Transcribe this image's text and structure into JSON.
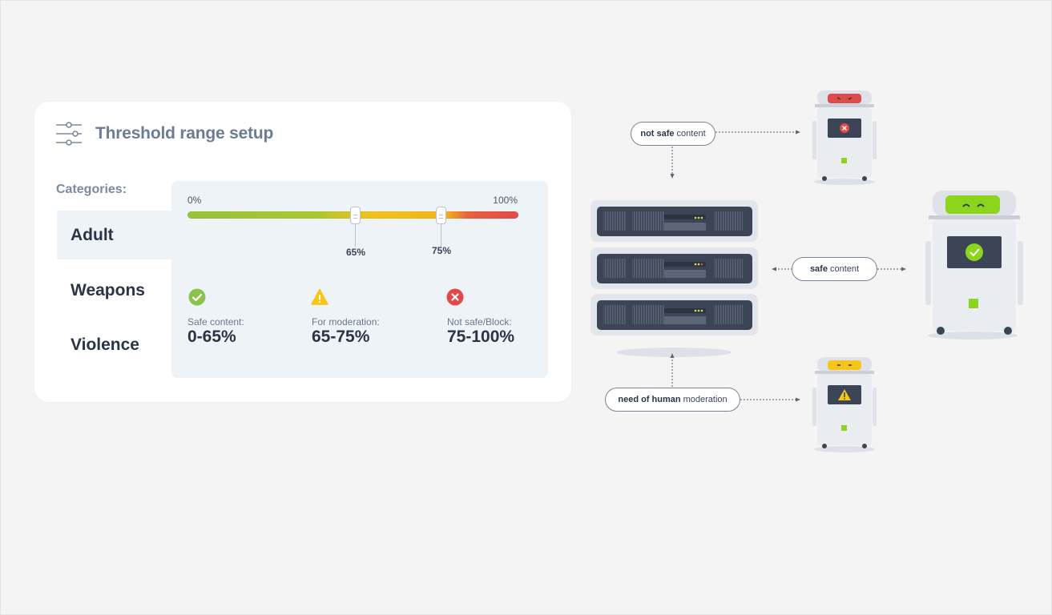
{
  "card": {
    "title": "Threshold range setup",
    "categories_label": "Categories:",
    "categories": [
      "Adult",
      "Weapons",
      "Violence"
    ],
    "selected_category": "Adult",
    "range": {
      "min_label": "0%",
      "max_label": "100%",
      "lower_threshold_label": "65%",
      "upper_threshold_label": "75%",
      "lower_threshold": 65,
      "upper_threshold": 75
    },
    "statuses": [
      {
        "title": "Safe content:",
        "value": "0-65%",
        "icon": "check-circle-icon",
        "color": "#8bc34a"
      },
      {
        "title": "For moderation:",
        "value": "65-75%",
        "icon": "warning-triangle-icon",
        "color": "#f5c518"
      },
      {
        "title": "Not safe/Block:",
        "value": "75-100%",
        "icon": "x-circle-icon",
        "color": "#e04a4a"
      }
    ]
  },
  "diagram": {
    "not_safe": {
      "bold": "not safe",
      "rest": "content"
    },
    "safe": {
      "bold": "safe",
      "rest": "content"
    },
    "human": {
      "bold": "need of human",
      "rest": "moderation"
    },
    "colors": {
      "red": "#e04a4a",
      "green": "#8bd61c",
      "yellow": "#f6c51b",
      "server": "#3c4556"
    }
  }
}
